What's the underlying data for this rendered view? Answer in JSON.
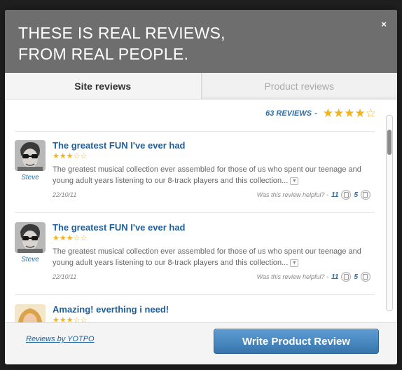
{
  "header": {
    "title_line1": "THESE IS REAL REVIEWS,",
    "title_line2": "FROM REAL PEOPLE.",
    "close_glyph": "×"
  },
  "tabs": [
    {
      "label": "Site reviews",
      "active": true
    },
    {
      "label": "Product reviews",
      "active": false
    }
  ],
  "summary": {
    "count_text": "63 REVIEWS",
    "separator": "-",
    "rating": 4,
    "stars_glyphs": "★★★★☆"
  },
  "reviews": [
    {
      "title": "The greatest FUN I've ever had",
      "rating": 3,
      "stars_glyphs": "★★★☆☆",
      "body": "The greatest musical collection ever assembled for those of us who spent our teenage and young adult years listening to our 8-track players and this collection...",
      "author": "Steve",
      "date": "22/10/11",
      "helpful_label": "Was this review helpful? -",
      "up_votes": "11",
      "down_votes": "5",
      "more_glyph": "▼"
    },
    {
      "title": "The greatest FUN I've ever had",
      "rating": 3,
      "stars_glyphs": "★★★☆☆",
      "body": "The greatest musical collection ever assembled for those of us who spent our teenage and young adult years listening to our 8-track players and this collection...",
      "author": "Steve",
      "date": "22/10/11",
      "helpful_label": "Was this review helpful? -",
      "up_votes": "11",
      "down_votes": "5",
      "more_glyph": "▼"
    },
    {
      "title": "Amazing! everthing i need!",
      "rating": 3,
      "stars_glyphs": "★★★☆☆"
    }
  ],
  "footer": {
    "yotpo_link": "Reviews by YOTPO",
    "write_button": "Write Product Review"
  },
  "colors": {
    "header_bg": "#6e6e6e",
    "link_blue": "#1d5f9c",
    "star_gold": "#f2b31b",
    "button_blue": "#4a88c2"
  }
}
